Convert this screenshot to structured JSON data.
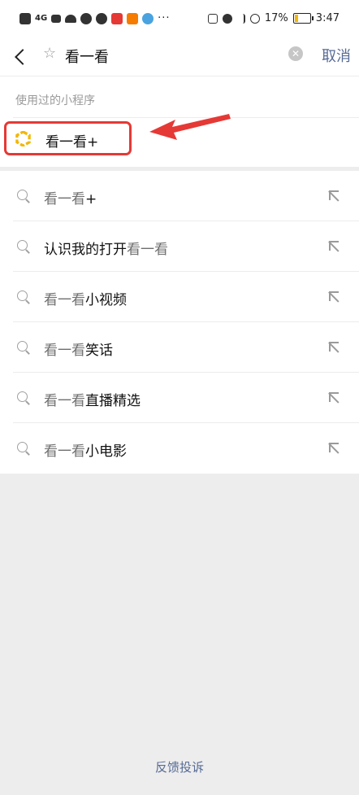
{
  "status_bar": {
    "network_label": "4G",
    "battery_percent": "17%",
    "time": "3:47",
    "more_indicator": "···",
    "left_icons": [
      "hd-icon",
      "signal-icon",
      "wifi-icon",
      "notification-icon",
      "app-icon",
      "app-icon",
      "app-icon",
      "app-icon"
    ],
    "right_icons": [
      "nfc-icon",
      "alarm-icon",
      "bluetooth-icon",
      "mute-icon",
      "battery-icon"
    ]
  },
  "search": {
    "query": "看一看",
    "cancel_label": "取消",
    "clear_icon": "clear-icon",
    "prefix_icon": "star-icon"
  },
  "used_mini_programs": {
    "label": "使用过的小程序",
    "items": [
      {
        "label": "看一看+",
        "icon": "mini-program-logo",
        "highlight_color": "#e53935"
      }
    ]
  },
  "suggestions": [
    {
      "highlight": "看一看",
      "rest": "+"
    },
    {
      "prefix": "认识我的打开",
      "highlight": "看一看",
      "rest": ""
    },
    {
      "highlight": "看一看",
      "rest": "小视频"
    },
    {
      "highlight": "看一看",
      "rest": "笑话"
    },
    {
      "highlight": "看一看",
      "rest": "直播精选"
    },
    {
      "highlight": "看一看",
      "rest": "小电影"
    }
  ],
  "footer": {
    "feedback_label": "反馈投诉"
  },
  "colors": {
    "link": "#576b95",
    "annotation": "#e53935",
    "logo": "#f2b705"
  }
}
